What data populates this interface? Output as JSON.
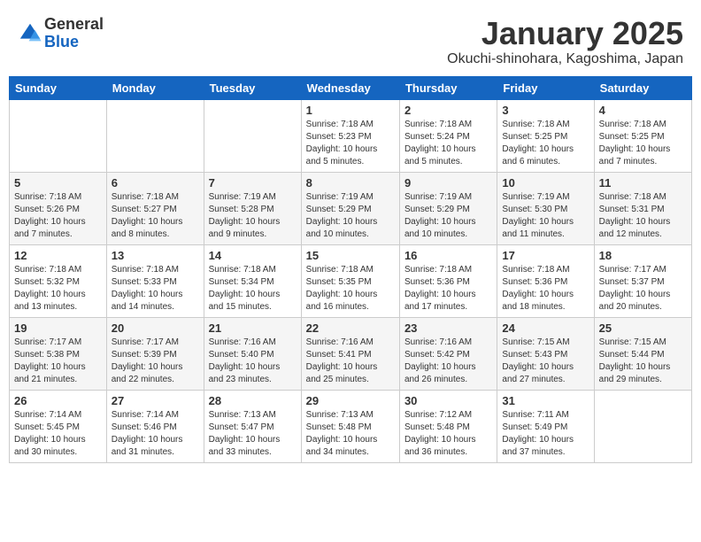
{
  "logo": {
    "general": "General",
    "blue": "Blue"
  },
  "calendar": {
    "title": "January 2025",
    "subtitle": "Okuchi-shinohara, Kagoshima, Japan",
    "headers": [
      "Sunday",
      "Monday",
      "Tuesday",
      "Wednesday",
      "Thursday",
      "Friday",
      "Saturday"
    ],
    "rows": [
      [
        {
          "num": "",
          "info": ""
        },
        {
          "num": "",
          "info": ""
        },
        {
          "num": "",
          "info": ""
        },
        {
          "num": "1",
          "info": "Sunrise: 7:18 AM\nSunset: 5:23 PM\nDaylight: 10 hours\nand 5 minutes."
        },
        {
          "num": "2",
          "info": "Sunrise: 7:18 AM\nSunset: 5:24 PM\nDaylight: 10 hours\nand 5 minutes."
        },
        {
          "num": "3",
          "info": "Sunrise: 7:18 AM\nSunset: 5:25 PM\nDaylight: 10 hours\nand 6 minutes."
        },
        {
          "num": "4",
          "info": "Sunrise: 7:18 AM\nSunset: 5:25 PM\nDaylight: 10 hours\nand 7 minutes."
        }
      ],
      [
        {
          "num": "5",
          "info": "Sunrise: 7:18 AM\nSunset: 5:26 PM\nDaylight: 10 hours\nand 7 minutes."
        },
        {
          "num": "6",
          "info": "Sunrise: 7:18 AM\nSunset: 5:27 PM\nDaylight: 10 hours\nand 8 minutes."
        },
        {
          "num": "7",
          "info": "Sunrise: 7:19 AM\nSunset: 5:28 PM\nDaylight: 10 hours\nand 9 minutes."
        },
        {
          "num": "8",
          "info": "Sunrise: 7:19 AM\nSunset: 5:29 PM\nDaylight: 10 hours\nand 10 minutes."
        },
        {
          "num": "9",
          "info": "Sunrise: 7:19 AM\nSunset: 5:29 PM\nDaylight: 10 hours\nand 10 minutes."
        },
        {
          "num": "10",
          "info": "Sunrise: 7:19 AM\nSunset: 5:30 PM\nDaylight: 10 hours\nand 11 minutes."
        },
        {
          "num": "11",
          "info": "Sunrise: 7:18 AM\nSunset: 5:31 PM\nDaylight: 10 hours\nand 12 minutes."
        }
      ],
      [
        {
          "num": "12",
          "info": "Sunrise: 7:18 AM\nSunset: 5:32 PM\nDaylight: 10 hours\nand 13 minutes."
        },
        {
          "num": "13",
          "info": "Sunrise: 7:18 AM\nSunset: 5:33 PM\nDaylight: 10 hours\nand 14 minutes."
        },
        {
          "num": "14",
          "info": "Sunrise: 7:18 AM\nSunset: 5:34 PM\nDaylight: 10 hours\nand 15 minutes."
        },
        {
          "num": "15",
          "info": "Sunrise: 7:18 AM\nSunset: 5:35 PM\nDaylight: 10 hours\nand 16 minutes."
        },
        {
          "num": "16",
          "info": "Sunrise: 7:18 AM\nSunset: 5:36 PM\nDaylight: 10 hours\nand 17 minutes."
        },
        {
          "num": "17",
          "info": "Sunrise: 7:18 AM\nSunset: 5:36 PM\nDaylight: 10 hours\nand 18 minutes."
        },
        {
          "num": "18",
          "info": "Sunrise: 7:17 AM\nSunset: 5:37 PM\nDaylight: 10 hours\nand 20 minutes."
        }
      ],
      [
        {
          "num": "19",
          "info": "Sunrise: 7:17 AM\nSunset: 5:38 PM\nDaylight: 10 hours\nand 21 minutes."
        },
        {
          "num": "20",
          "info": "Sunrise: 7:17 AM\nSunset: 5:39 PM\nDaylight: 10 hours\nand 22 minutes."
        },
        {
          "num": "21",
          "info": "Sunrise: 7:16 AM\nSunset: 5:40 PM\nDaylight: 10 hours\nand 23 minutes."
        },
        {
          "num": "22",
          "info": "Sunrise: 7:16 AM\nSunset: 5:41 PM\nDaylight: 10 hours\nand 25 minutes."
        },
        {
          "num": "23",
          "info": "Sunrise: 7:16 AM\nSunset: 5:42 PM\nDaylight: 10 hours\nand 26 minutes."
        },
        {
          "num": "24",
          "info": "Sunrise: 7:15 AM\nSunset: 5:43 PM\nDaylight: 10 hours\nand 27 minutes."
        },
        {
          "num": "25",
          "info": "Sunrise: 7:15 AM\nSunset: 5:44 PM\nDaylight: 10 hours\nand 29 minutes."
        }
      ],
      [
        {
          "num": "26",
          "info": "Sunrise: 7:14 AM\nSunset: 5:45 PM\nDaylight: 10 hours\nand 30 minutes."
        },
        {
          "num": "27",
          "info": "Sunrise: 7:14 AM\nSunset: 5:46 PM\nDaylight: 10 hours\nand 31 minutes."
        },
        {
          "num": "28",
          "info": "Sunrise: 7:13 AM\nSunset: 5:47 PM\nDaylight: 10 hours\nand 33 minutes."
        },
        {
          "num": "29",
          "info": "Sunrise: 7:13 AM\nSunset: 5:48 PM\nDaylight: 10 hours\nand 34 minutes."
        },
        {
          "num": "30",
          "info": "Sunrise: 7:12 AM\nSunset: 5:48 PM\nDaylight: 10 hours\nand 36 minutes."
        },
        {
          "num": "31",
          "info": "Sunrise: 7:11 AM\nSunset: 5:49 PM\nDaylight: 10 hours\nand 37 minutes."
        },
        {
          "num": "",
          "info": ""
        }
      ]
    ]
  }
}
